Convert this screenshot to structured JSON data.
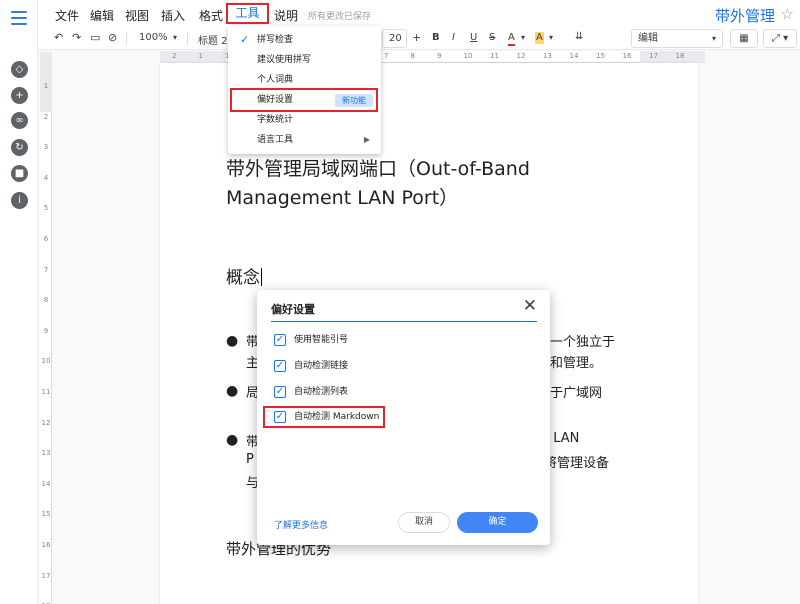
{
  "menubar": {
    "items": [
      "文件",
      "编辑",
      "视图",
      "插入",
      "格式"
    ],
    "tools": "工具",
    "help": "说明",
    "saved_status": "所有更改已保存",
    "doc_title": "带外管理"
  },
  "toolbar": {
    "zoom": "100%",
    "style": "标题 2",
    "font_size": "20",
    "mode": "编辑"
  },
  "ruler": {
    "h_numbers": [
      "2",
      "1",
      "1",
      "2",
      "3",
      "4",
      "5",
      "6",
      "7",
      "8",
      "9",
      "10",
      "11",
      "12",
      "13",
      "14",
      "15",
      "16",
      "17",
      "18"
    ],
    "v_numbers": [
      "1",
      "2",
      "3",
      "4",
      "5",
      "6",
      "7",
      "8",
      "9",
      "10",
      "11",
      "12",
      "13",
      "14",
      "15",
      "16",
      "17",
      "18"
    ]
  },
  "tools_menu": {
    "items": [
      {
        "label": "拼写检查",
        "checked": true
      },
      {
        "label": "建议使用拼写"
      },
      {
        "label": "个人词典"
      },
      {
        "label": "偏好设置",
        "badge": "新功能"
      },
      {
        "label": "字数统计"
      },
      {
        "label": "语言工具",
        "submenu": true
      }
    ]
  },
  "document": {
    "heading1": "带外管理局域网端口（Out-of-Band Management LAN Port）",
    "heading2": "概念",
    "bullet1_left1": "带",
    "bullet1_left2": "主",
    "bullet1_right1": "一个独立于",
    "bullet1_right2": "和管理。",
    "bullet2_left": "局",
    "bullet2_right": "于广域网",
    "bullet3_left1": "带",
    "bullet3_left2": "P",
    "bullet3_left3": "与",
    "bullet3_right1": "t LAN",
    "bullet3_right2": "将管理设备",
    "heading3": "带外管理的优势"
  },
  "dialog": {
    "title": "偏好设置",
    "options": [
      {
        "label": "使用智能引号",
        "checked": true
      },
      {
        "label": "自动检测链接",
        "checked": true
      },
      {
        "label": "自动检测列表",
        "checked": true
      },
      {
        "label": "自动检测 Markdown",
        "checked": true
      }
    ],
    "learn_more": "了解更多信息",
    "cancel": "取消",
    "ok": "确定"
  }
}
